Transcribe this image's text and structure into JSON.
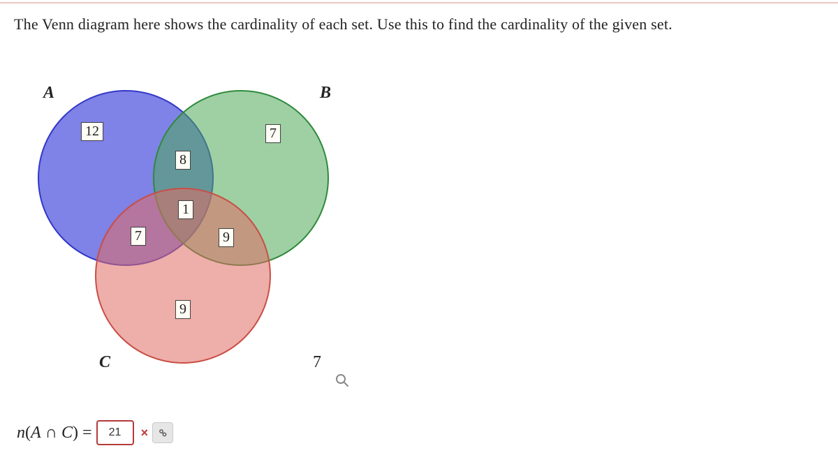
{
  "prompt": "The Venn diagram here shows the cardinality of each set. Use this to find the cardinality of the given set.",
  "sets": {
    "A": {
      "label": "A"
    },
    "B": {
      "label": "B"
    },
    "C": {
      "label": "C"
    }
  },
  "regions": {
    "A_only": "12",
    "B_only": "7",
    "C_only": "9",
    "A_and_B": "8",
    "A_and_C": "7",
    "B_and_C": "9",
    "A_B_C": "1"
  },
  "outside": "7",
  "answer": {
    "expression_lhs": "n(A ∩ C) =",
    "value": "21",
    "status": "incorrect",
    "status_mark": "×"
  },
  "colors": {
    "A": "#5b5fdf",
    "B": "#4faa5a",
    "C": "#e06b62"
  },
  "chart_data": {
    "type": "venn3",
    "sets": [
      "A",
      "B",
      "C"
    ],
    "regions": {
      "A": 12,
      "B": 7,
      "C": 9,
      "A∩B": 8,
      "A∩C": 7,
      "B∩C": 9,
      "A∩B∩C": 1,
      "outside": 7
    },
    "question": "n(A ∩ C)",
    "submitted_answer": 21,
    "submitted_answer_correct": false
  }
}
